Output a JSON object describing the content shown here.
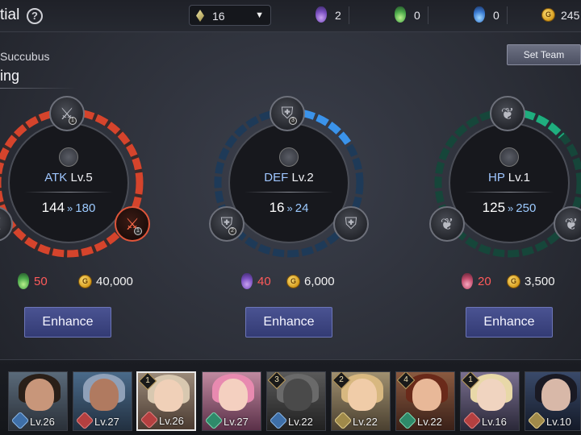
{
  "header": {
    "title": "tial",
    "filter_value": "16",
    "resources": [
      {
        "icon": "purple-potion-icon",
        "value": "2"
      },
      {
        "icon": "green-potion-icon",
        "value": "0"
      },
      {
        "icon": "blue-potion-icon",
        "value": "0"
      },
      {
        "icon": "gold-coin-icon",
        "value": "245"
      }
    ]
  },
  "sub": {
    "subtitle": "Succubus",
    "heading": "ing",
    "set_team_label": "Set Team"
  },
  "stats": [
    {
      "name": "ATK",
      "level": "Lv.5",
      "current": "144",
      "next": "180",
      "potion_cost": "50",
      "gold_cost": "40,000",
      "button": "Enhance",
      "color": "#e0553a",
      "potion_icon": "green-potion-icon"
    },
    {
      "name": "DEF",
      "level": "Lv.2",
      "current": "16",
      "next": "24",
      "potion_cost": "40",
      "gold_cost": "6,000",
      "button": "Enhance",
      "color": "#3a8ee0",
      "potion_icon": "purple-potion-icon"
    },
    {
      "name": "HP",
      "level": "Lv.1",
      "current": "125",
      "next": "250",
      "potion_cost": "20",
      "gold_cost": "3,500",
      "button": "Enhance",
      "color": "#1fae7e",
      "potion_icon": "pink-potion-icon"
    }
  ],
  "roster": [
    {
      "level": "Lv.26",
      "class": "def",
      "rank": ""
    },
    {
      "level": "Lv.27",
      "class": "atk",
      "rank": ""
    },
    {
      "level": "Lv.26",
      "class": "atk",
      "rank": "1",
      "selected": true
    },
    {
      "level": "Lv.27",
      "class": "hp",
      "rank": ""
    },
    {
      "level": "Lv.22",
      "class": "def",
      "rank": "3"
    },
    {
      "level": "Lv.22",
      "class": "sup",
      "rank": "2"
    },
    {
      "level": "Lv.22",
      "class": "hp",
      "rank": "4"
    },
    {
      "level": "Lv.16",
      "class": "atk",
      "rank": "1"
    },
    {
      "level": "Lv.10",
      "class": "sup",
      "rank": ""
    }
  ]
}
